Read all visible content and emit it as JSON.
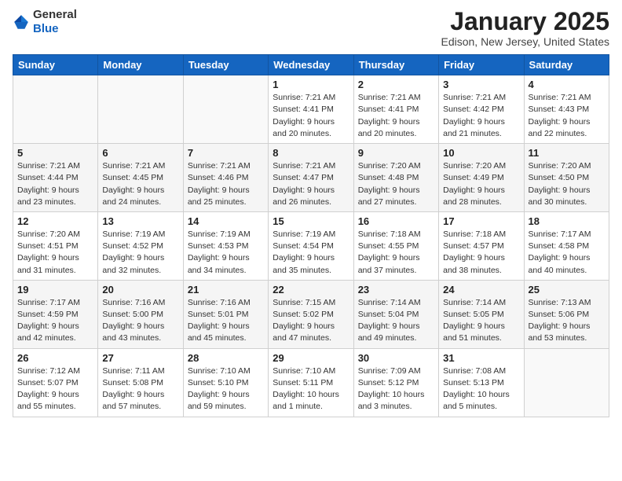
{
  "logo": {
    "text_general": "General",
    "text_blue": "Blue"
  },
  "header": {
    "month": "January 2025",
    "location": "Edison, New Jersey, United States"
  },
  "weekdays": [
    "Sunday",
    "Monday",
    "Tuesday",
    "Wednesday",
    "Thursday",
    "Friday",
    "Saturday"
  ],
  "weeks": [
    [
      {
        "day": "",
        "info": ""
      },
      {
        "day": "",
        "info": ""
      },
      {
        "day": "",
        "info": ""
      },
      {
        "day": "1",
        "info": "Sunrise: 7:21 AM\nSunset: 4:41 PM\nDaylight: 9 hours\nand 20 minutes."
      },
      {
        "day": "2",
        "info": "Sunrise: 7:21 AM\nSunset: 4:41 PM\nDaylight: 9 hours\nand 20 minutes."
      },
      {
        "day": "3",
        "info": "Sunrise: 7:21 AM\nSunset: 4:42 PM\nDaylight: 9 hours\nand 21 minutes."
      },
      {
        "day": "4",
        "info": "Sunrise: 7:21 AM\nSunset: 4:43 PM\nDaylight: 9 hours\nand 22 minutes."
      }
    ],
    [
      {
        "day": "5",
        "info": "Sunrise: 7:21 AM\nSunset: 4:44 PM\nDaylight: 9 hours\nand 23 minutes."
      },
      {
        "day": "6",
        "info": "Sunrise: 7:21 AM\nSunset: 4:45 PM\nDaylight: 9 hours\nand 24 minutes."
      },
      {
        "day": "7",
        "info": "Sunrise: 7:21 AM\nSunset: 4:46 PM\nDaylight: 9 hours\nand 25 minutes."
      },
      {
        "day": "8",
        "info": "Sunrise: 7:21 AM\nSunset: 4:47 PM\nDaylight: 9 hours\nand 26 minutes."
      },
      {
        "day": "9",
        "info": "Sunrise: 7:20 AM\nSunset: 4:48 PM\nDaylight: 9 hours\nand 27 minutes."
      },
      {
        "day": "10",
        "info": "Sunrise: 7:20 AM\nSunset: 4:49 PM\nDaylight: 9 hours\nand 28 minutes."
      },
      {
        "day": "11",
        "info": "Sunrise: 7:20 AM\nSunset: 4:50 PM\nDaylight: 9 hours\nand 30 minutes."
      }
    ],
    [
      {
        "day": "12",
        "info": "Sunrise: 7:20 AM\nSunset: 4:51 PM\nDaylight: 9 hours\nand 31 minutes."
      },
      {
        "day": "13",
        "info": "Sunrise: 7:19 AM\nSunset: 4:52 PM\nDaylight: 9 hours\nand 32 minutes."
      },
      {
        "day": "14",
        "info": "Sunrise: 7:19 AM\nSunset: 4:53 PM\nDaylight: 9 hours\nand 34 minutes."
      },
      {
        "day": "15",
        "info": "Sunrise: 7:19 AM\nSunset: 4:54 PM\nDaylight: 9 hours\nand 35 minutes."
      },
      {
        "day": "16",
        "info": "Sunrise: 7:18 AM\nSunset: 4:55 PM\nDaylight: 9 hours\nand 37 minutes."
      },
      {
        "day": "17",
        "info": "Sunrise: 7:18 AM\nSunset: 4:57 PM\nDaylight: 9 hours\nand 38 minutes."
      },
      {
        "day": "18",
        "info": "Sunrise: 7:17 AM\nSunset: 4:58 PM\nDaylight: 9 hours\nand 40 minutes."
      }
    ],
    [
      {
        "day": "19",
        "info": "Sunrise: 7:17 AM\nSunset: 4:59 PM\nDaylight: 9 hours\nand 42 minutes."
      },
      {
        "day": "20",
        "info": "Sunrise: 7:16 AM\nSunset: 5:00 PM\nDaylight: 9 hours\nand 43 minutes."
      },
      {
        "day": "21",
        "info": "Sunrise: 7:16 AM\nSunset: 5:01 PM\nDaylight: 9 hours\nand 45 minutes."
      },
      {
        "day": "22",
        "info": "Sunrise: 7:15 AM\nSunset: 5:02 PM\nDaylight: 9 hours\nand 47 minutes."
      },
      {
        "day": "23",
        "info": "Sunrise: 7:14 AM\nSunset: 5:04 PM\nDaylight: 9 hours\nand 49 minutes."
      },
      {
        "day": "24",
        "info": "Sunrise: 7:14 AM\nSunset: 5:05 PM\nDaylight: 9 hours\nand 51 minutes."
      },
      {
        "day": "25",
        "info": "Sunrise: 7:13 AM\nSunset: 5:06 PM\nDaylight: 9 hours\nand 53 minutes."
      }
    ],
    [
      {
        "day": "26",
        "info": "Sunrise: 7:12 AM\nSunset: 5:07 PM\nDaylight: 9 hours\nand 55 minutes."
      },
      {
        "day": "27",
        "info": "Sunrise: 7:11 AM\nSunset: 5:08 PM\nDaylight: 9 hours\nand 57 minutes."
      },
      {
        "day": "28",
        "info": "Sunrise: 7:10 AM\nSunset: 5:10 PM\nDaylight: 9 hours\nand 59 minutes."
      },
      {
        "day": "29",
        "info": "Sunrise: 7:10 AM\nSunset: 5:11 PM\nDaylight: 10 hours\nand 1 minute."
      },
      {
        "day": "30",
        "info": "Sunrise: 7:09 AM\nSunset: 5:12 PM\nDaylight: 10 hours\nand 3 minutes."
      },
      {
        "day": "31",
        "info": "Sunrise: 7:08 AM\nSunset: 5:13 PM\nDaylight: 10 hours\nand 5 minutes."
      },
      {
        "day": "",
        "info": ""
      }
    ]
  ]
}
